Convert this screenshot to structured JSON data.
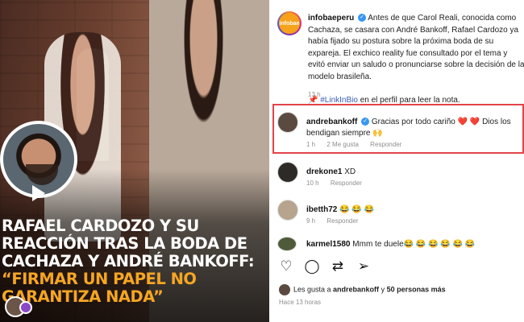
{
  "headline": {
    "lines": [
      {
        "text": "Rafael Cardozo y su",
        "color": "white"
      },
      {
        "text": "reacción tras la boda de",
        "color": "white"
      },
      {
        "text": "Cachaza y André Bankoff:",
        "color": "white"
      },
      {
        "text": "“Firmar un papel no",
        "color": "orange"
      },
      {
        "text": "garantiza nada”",
        "color": "orange"
      }
    ]
  },
  "post": {
    "logo_text": "infobae",
    "username": "infobaeperu",
    "caption": "Antes de que Carol Reali, conocida como Cachaza, se casara con André Bankoff, Rafael Cardozo ya había fijado su postura sobre la próxima boda de su expareja. El exchico reality fue consultado por el tema y evitó enviar un saludo o pronunciarse sobre la decisión de la modelo brasileña.",
    "link_tag": "#LinkInBio",
    "link_rest": " en el perfil para leer la nota.",
    "time": "13 h"
  },
  "comments": [
    {
      "username": "andrebankoff",
      "verified": true,
      "text": "Gracias por todo cariño ❤️ ❤️ Dios los bendigan siempre 🙌",
      "time": "1 h",
      "likes": "2 Me gusta",
      "reply": "Responder"
    },
    {
      "username": "drekone1",
      "text": "XD",
      "time": "10 h",
      "reply": "Responder"
    },
    {
      "username": "ibetth72",
      "text": "😂 😂 😂",
      "time": "9 h",
      "reply": "Responder"
    },
    {
      "username": "karmel1580",
      "text": "Mmm te duele😂 😂 😂 😂 😂 😂",
      "time": "",
      "reply": ""
    }
  ],
  "actions": [
    "heart-icon",
    "comment-icon",
    "repost-icon",
    "share-icon"
  ],
  "likes": {
    "prefix": "Les gusta a ",
    "user": "andrebankoff",
    "middle": " y ",
    "count": "50 personas más"
  },
  "posted_ago": "Hace 13 horas",
  "colors": {
    "accent_orange": "#f5a623",
    "highlight_red": "#e2444a",
    "link_blue": "#3a5bb5"
  }
}
